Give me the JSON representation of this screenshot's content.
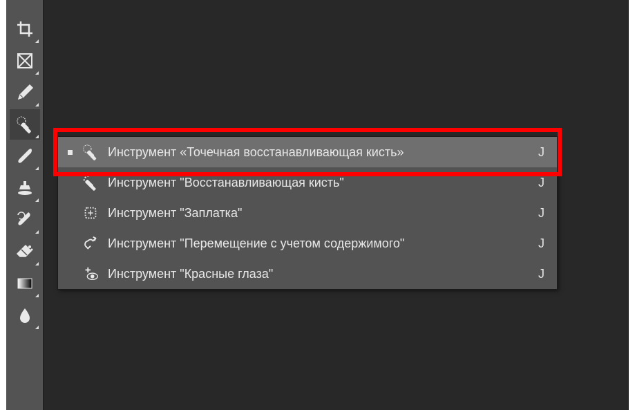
{
  "toolbar": {
    "tools": [
      {
        "name": "crop",
        "active": false
      },
      {
        "name": "frame",
        "active": false
      },
      {
        "name": "eyedropper",
        "active": false
      },
      {
        "name": "spot-healing-brush",
        "active": true
      },
      {
        "name": "brush",
        "active": false
      },
      {
        "name": "clone-stamp",
        "active": false
      },
      {
        "name": "history-brush",
        "active": false
      },
      {
        "name": "eraser",
        "active": false
      },
      {
        "name": "gradient",
        "active": false
      },
      {
        "name": "blur",
        "active": false
      }
    ]
  },
  "flyout": {
    "items": [
      {
        "label": "Инструмент «Точечная восстанавливающая кисть»",
        "shortcut": "J",
        "icon": "spot-healing-brush-icon",
        "current": true,
        "hovered": true
      },
      {
        "label": "Инструмент \"Восстанавливающая кисть\"",
        "shortcut": "J",
        "icon": "healing-brush-icon",
        "current": false,
        "hovered": false
      },
      {
        "label": "Инструмент \"Заплатка\"",
        "shortcut": "J",
        "icon": "patch-icon",
        "current": false,
        "hovered": false
      },
      {
        "label": "Инструмент \"Перемещение с учетом содержимого\"",
        "shortcut": "J",
        "icon": "content-aware-move-icon",
        "current": false,
        "hovered": false
      },
      {
        "label": "Инструмент \"Красные глаза\"",
        "shortcut": "J",
        "icon": "red-eye-icon",
        "current": false,
        "hovered": false
      }
    ]
  }
}
